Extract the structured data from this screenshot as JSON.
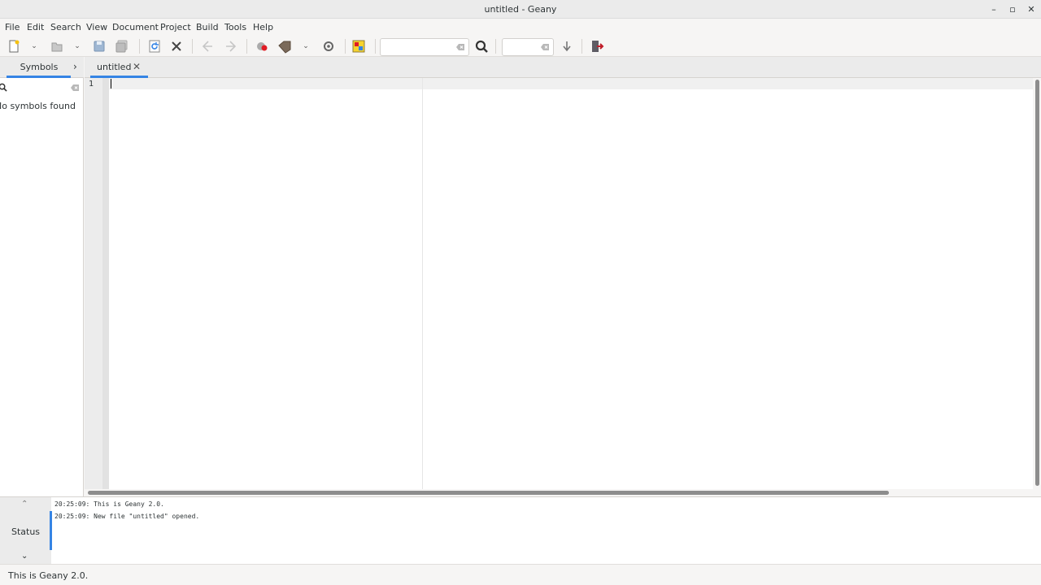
{
  "window": {
    "title": "untitled - Geany",
    "minimize_glyph": "–",
    "maximize_glyph": "▫",
    "close_glyph": "✕"
  },
  "menu": {
    "items": [
      "File",
      "Edit",
      "Search",
      "View",
      "Document",
      "Project",
      "Build",
      "Tools",
      "Help"
    ]
  },
  "toolbar": {
    "icons": [
      "new-file-icon",
      "open-file-icon",
      "save-icon",
      "save-all-icon",
      "reload-icon",
      "close-icon",
      "back-icon",
      "forward-icon",
      "compile-icon",
      "build-icon",
      "execute-icon",
      "color-chooser-icon",
      "search-icon",
      "jump-to-line-icon",
      "quit-icon"
    ],
    "search_value": "",
    "goto_line_value": ""
  },
  "sidebar": {
    "tab_label": "Symbols",
    "search_value": "",
    "empty_message": "No symbols found"
  },
  "editor": {
    "tab_label": "untitled",
    "tab_close_glyph": "✕",
    "line_number": "1"
  },
  "messages": {
    "tab_label": "Status",
    "lines": [
      "20:25:09: This is Geany 2.0.",
      "20:25:09: New file \"untitled\" opened."
    ]
  },
  "statusbar": {
    "text": "This is Geany 2.0."
  },
  "colors": {
    "accent": "#3584e4",
    "quit_icon": "#c01c28"
  }
}
